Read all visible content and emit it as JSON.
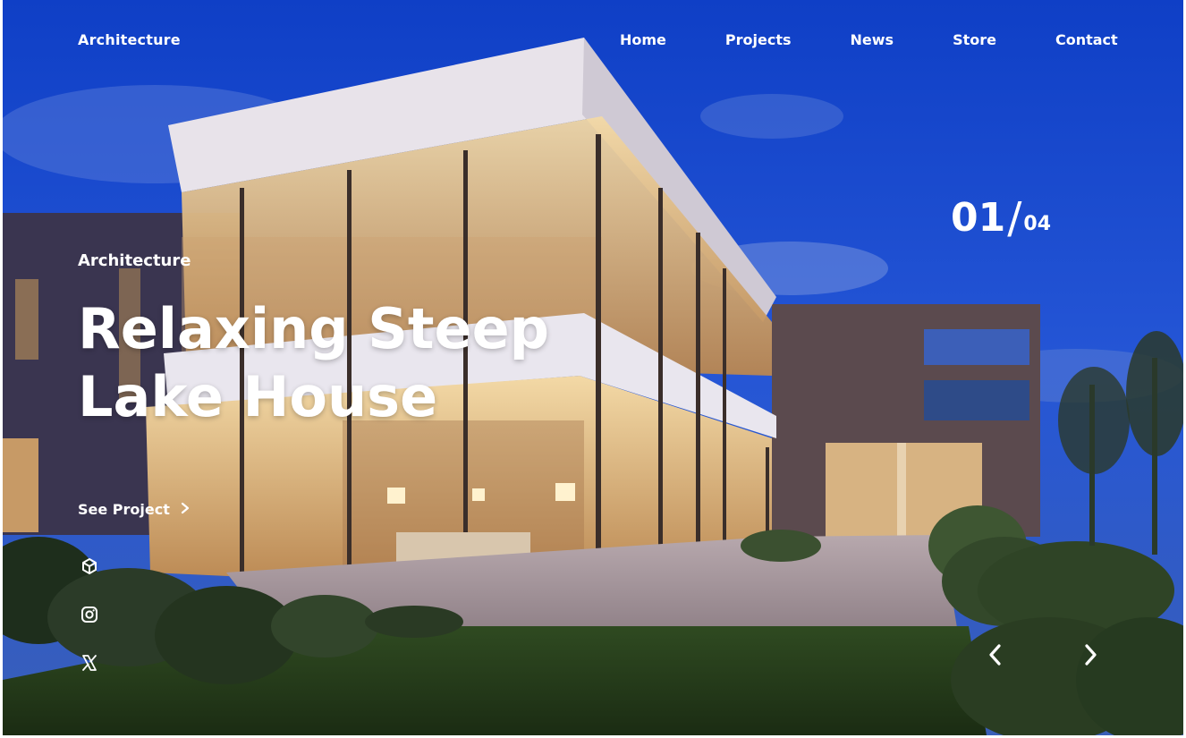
{
  "header": {
    "brand": "Architecture",
    "nav": [
      "Home",
      "Projects",
      "News",
      "Store",
      "Contact"
    ]
  },
  "slide": {
    "current": "01",
    "separator": "/",
    "total": "04",
    "kicker": "Architecture",
    "title_line1": "Relaxing Steep",
    "title_line2": "Lake House",
    "cta": "See Project",
    "cta_icon": "chevron-right-icon"
  },
  "social": [
    "cube-icon",
    "instagram-icon",
    "x-icon"
  ],
  "controls": {
    "prev_icon": "chevron-left-icon",
    "next_icon": "chevron-right-icon"
  },
  "colors": {
    "sky": "#1f4fd1",
    "text": "#ffffff",
    "warm_light": "#f0c27a"
  }
}
